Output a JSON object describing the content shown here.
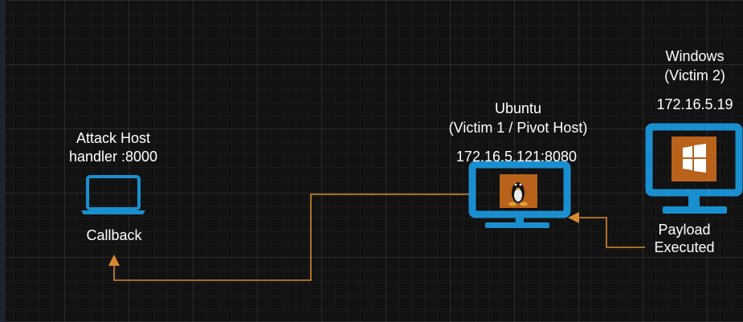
{
  "colors": {
    "device": "#1a8fd0",
    "logo_tile": "#b8621b",
    "connector": "#d8892e",
    "background": "#121212"
  },
  "nodes": {
    "attack_host": {
      "title": "Attack Host",
      "subtitle": "handler :8000",
      "note": "Callback",
      "icon": "laptop-icon"
    },
    "ubuntu": {
      "title": "Ubuntu",
      "subtitle": "(Victim 1 / Pivot Host)",
      "address": "172.16.5.121:8080",
      "icon": "linux-tux-icon"
    },
    "windows": {
      "title": "Windows",
      "subtitle": "(Victim 2)",
      "address": "172.16.5.19",
      "note_line1": "Payload",
      "note_line2": "Executed",
      "icon": "windows-logo-icon"
    }
  }
}
